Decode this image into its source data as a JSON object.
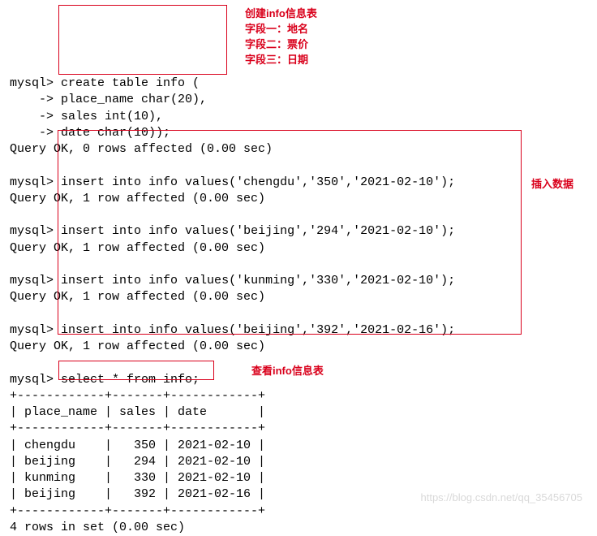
{
  "prompts": {
    "mysql": "mysql>",
    "cont": "    ->"
  },
  "create": {
    "l1": "create table info (",
    "l2": "place_name char(20),",
    "l3": "sales int(10),",
    "l4": "date char(10));",
    "result": "Query OK, 0 rows affected (0.00 sec)"
  },
  "inserts": [
    {
      "cmd": "insert into info values('chengdu','350','2021-02-10');",
      "result": "Query OK, 1 row affected (0.00 sec)"
    },
    {
      "cmd": "insert into info values('beijing','294','2021-02-10');",
      "result": "Query OK, 1 row affected (0.00 sec)"
    },
    {
      "cmd": "insert into info values('kunming','330','2021-02-10');",
      "result": "Query OK, 1 row affected (0.00 sec)"
    },
    {
      "cmd": "insert into info values('beijing','392','2021-02-16');",
      "result": "Query OK, 1 row affected (0.00 sec)"
    }
  ],
  "select": {
    "cmd": "select * from info;",
    "border": "+------------+-------+------------+",
    "header": "| place_name | sales | date       |",
    "rows": [
      "| chengdu    |   350 | 2021-02-10 |",
      "| beijing    |   294 | 2021-02-10 |",
      "| kunming    |   330 | 2021-02-10 |",
      "| beijing    |   392 | 2021-02-16 |"
    ],
    "footer": "4 rows in set (0.00 sec)"
  },
  "annotations": {
    "create_title": "创建info信息表",
    "create_f1": "字段一：地名",
    "create_f2": "字段二：票价",
    "create_f3": "字段三：日期",
    "insert": "插入数据",
    "select": "查看info信息表"
  },
  "watermark": "https://blog.csdn.net/qq_35456705"
}
